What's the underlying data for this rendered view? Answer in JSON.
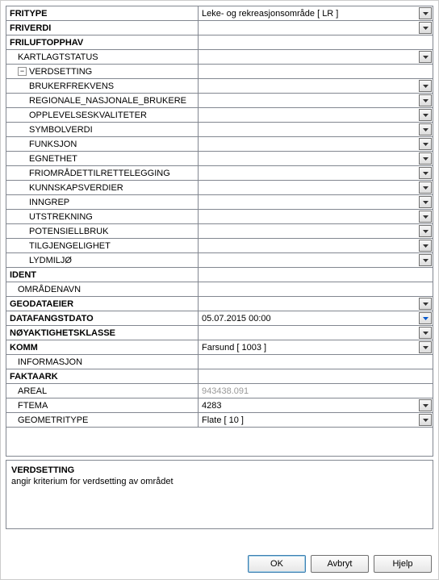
{
  "rows": [
    {
      "label": "FRITYPE",
      "value": "Leke- og rekreasjonsområde [ LR ]",
      "bold": true,
      "indent": 0,
      "dd": true
    },
    {
      "label": "FRIVERDI",
      "value": "",
      "bold": true,
      "indent": 0,
      "dd": true
    },
    {
      "label": "FRILUFTOPPHAV",
      "value": "",
      "bold": true,
      "indent": 0,
      "dd": false
    },
    {
      "label": "KARTLAGTSTATUS",
      "value": "",
      "bold": false,
      "indent": 1,
      "dd": true
    },
    {
      "label": "VERDSETTING",
      "value": "",
      "bold": false,
      "indent": 1,
      "dd": false,
      "expander": true
    },
    {
      "label": "BRUKERFREKVENS",
      "value": "",
      "bold": false,
      "indent": 2,
      "dd": true
    },
    {
      "label": "REGIONALE_NASJONALE_BRUKERE",
      "value": "",
      "bold": false,
      "indent": 2,
      "dd": true
    },
    {
      "label": "OPPLEVELSESKVALITETER",
      "value": "",
      "bold": false,
      "indent": 2,
      "dd": true
    },
    {
      "label": "SYMBOLVERDI",
      "value": "",
      "bold": false,
      "indent": 2,
      "dd": true
    },
    {
      "label": "FUNKSJON",
      "value": "",
      "bold": false,
      "indent": 2,
      "dd": true
    },
    {
      "label": "EGNETHET",
      "value": "",
      "bold": false,
      "indent": 2,
      "dd": true
    },
    {
      "label": "FRIOMRÅDETTILRETTELEGGING",
      "value": "",
      "bold": false,
      "indent": 2,
      "dd": true
    },
    {
      "label": "KUNNSKAPSVERDIER",
      "value": "",
      "bold": false,
      "indent": 2,
      "dd": true
    },
    {
      "label": "INNGREP",
      "value": "",
      "bold": false,
      "indent": 2,
      "dd": true
    },
    {
      "label": "UTSTREKNING",
      "value": "",
      "bold": false,
      "indent": 2,
      "dd": true
    },
    {
      "label": "POTENSIELLBRUK",
      "value": "",
      "bold": false,
      "indent": 2,
      "dd": true
    },
    {
      "label": "TILGJENGELIGHET",
      "value": "",
      "bold": false,
      "indent": 2,
      "dd": true
    },
    {
      "label": "LYDMILJØ",
      "value": "",
      "bold": false,
      "indent": 2,
      "dd": true
    },
    {
      "label": "IDENT",
      "value": "",
      "bold": true,
      "indent": 0,
      "dd": false
    },
    {
      "label": "OMRÅDENAVN",
      "value": "",
      "bold": false,
      "indent": 1,
      "dd": false
    },
    {
      "label": "GEODATAEIER",
      "value": "",
      "bold": true,
      "indent": 0,
      "dd": true
    },
    {
      "label": "DATAFANGSTDATO",
      "value": "05.07.2015 00:00",
      "bold": true,
      "indent": 0,
      "dd": true,
      "blue": true
    },
    {
      "label": "NØYAKTIGHETSKLASSE",
      "value": "",
      "bold": true,
      "indent": 0,
      "dd": true
    },
    {
      "label": "KOMM",
      "value": "Farsund [ 1003 ]",
      "bold": true,
      "indent": 0,
      "dd": true
    },
    {
      "label": "INFORMASJON",
      "value": "",
      "bold": false,
      "indent": 1,
      "dd": false
    },
    {
      "label": "FAKTAARK",
      "value": "",
      "bold": true,
      "indent": 0,
      "dd": false
    },
    {
      "label": "AREAL",
      "value": "943438.091",
      "bold": false,
      "indent": 1,
      "dd": false,
      "gray": true
    },
    {
      "label": "FTEMA",
      "value": "4283",
      "bold": false,
      "indent": 1,
      "dd": true
    },
    {
      "label": "GEOMETRITYPE",
      "value": "Flate [ 10 ]",
      "bold": false,
      "indent": 1,
      "dd": true
    }
  ],
  "expander_symbol": "−",
  "description": {
    "title": "VERDSETTING",
    "text": "angir kriterium for verdsetting av området"
  },
  "buttons": {
    "ok": "OK",
    "cancel": "Avbryt",
    "help": "Hjelp"
  }
}
